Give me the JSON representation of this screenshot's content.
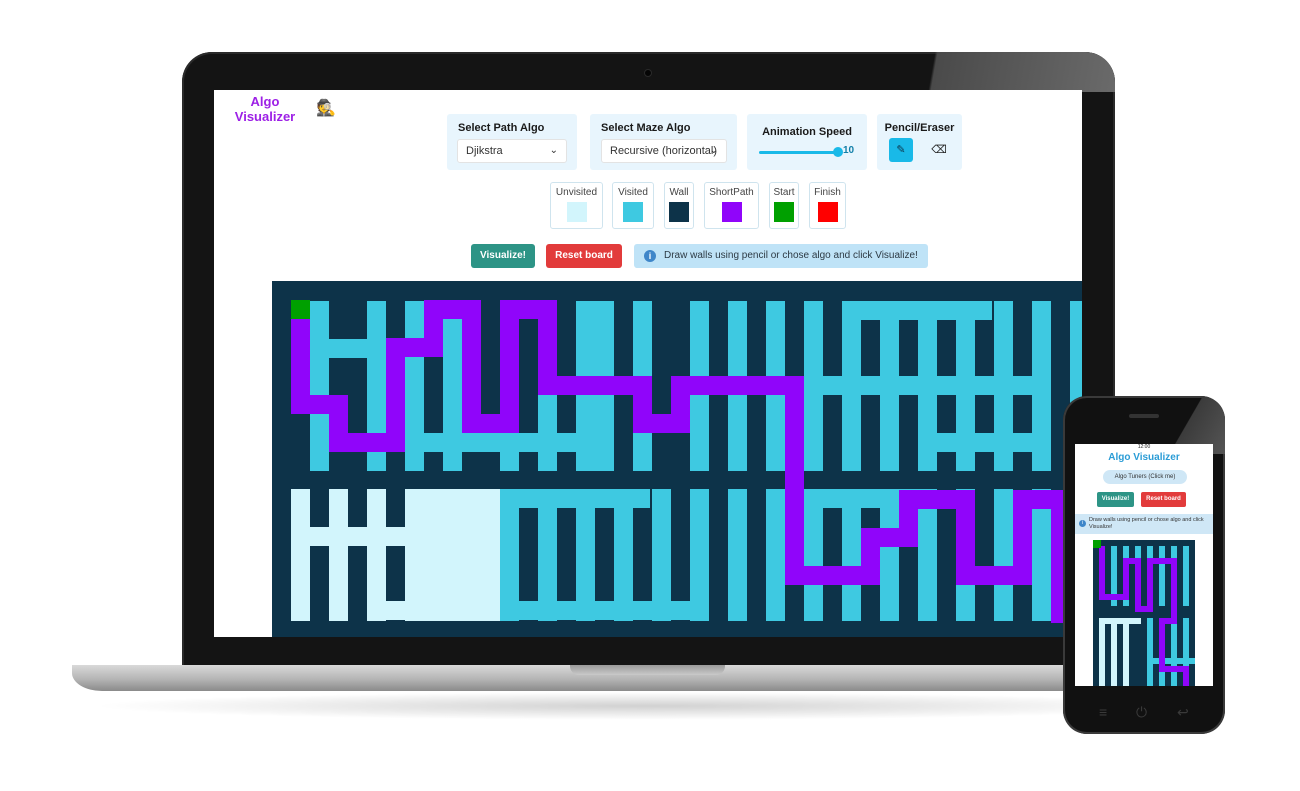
{
  "laptop": {
    "brand": {
      "line1": "Algo",
      "line2": "Visualizer"
    },
    "controls": {
      "path_algo": {
        "title": "Select Path Algo",
        "selected": "Djikstra"
      },
      "maze_algo": {
        "title": "Select Maze Algo",
        "selected": "Recursive (horizontal)"
      },
      "speed": {
        "title": "Animation Speed",
        "value": "10",
        "level": 1.0
      },
      "tools": {
        "title": "Pencil/Eraser",
        "active": "pencil"
      }
    },
    "legend": [
      {
        "label": "Unvisited",
        "color": "#d2f5fc"
      },
      {
        "label": "Visited",
        "color": "#3ec9e1"
      },
      {
        "label": "Wall",
        "color": "#0d3349"
      },
      {
        "label": "ShortPath",
        "color": "#9005fa"
      },
      {
        "label": "Start",
        "color": "#00a000"
      },
      {
        "label": "Finish",
        "color": "#ff0000"
      }
    ],
    "actions": {
      "visualize": "Visualize!",
      "reset": "Reset board"
    },
    "info": "Draw walls using pencil or chose algo and click Visualize!"
  },
  "phone": {
    "status_time": "12:00",
    "title": "Algo Visualizer",
    "tuners": "Algo Tuners (Click me)",
    "actions": {
      "visualize": "Visualize!",
      "reset": "Reset board"
    },
    "info": "Draw walls using pencil or chose algo and click Visualize!"
  },
  "colors": {
    "wall": "#0d3349",
    "visited": "#3ec9e1",
    "unvisited": "#d2f5fc",
    "path": "#9005fa",
    "start": "#00a000",
    "finish": "#ff0000",
    "visualize_btn": "#2d9486",
    "reset_btn": "#e23b3b"
  }
}
